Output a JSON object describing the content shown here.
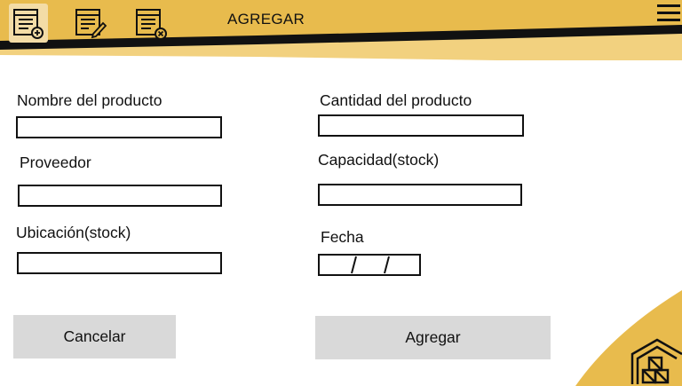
{
  "colors": {
    "accent": "#e8bb4d",
    "accent_light": "#f2d17f",
    "band_dark": "#111111",
    "button_bg": "#d9d9d9"
  },
  "toolbar": {
    "title": "AGREGAR",
    "icons": [
      "document-add-icon",
      "document-edit-icon",
      "document-delete-icon",
      "menu-icon"
    ]
  },
  "form": {
    "nombre_label": "Nombre del producto",
    "nombre_value": "",
    "proveedor_label": "Proveedor",
    "proveedor_value": "",
    "ubicacion_label": "Ubicación(stock)",
    "ubicacion_value": "",
    "cantidad_label": "Cantidad del producto",
    "cantidad_value": "",
    "capacidad_label": "Capacidad(stock)",
    "capacidad_value": "",
    "fecha_label": "Fecha",
    "fecha_value": ""
  },
  "buttons": {
    "cancel": "Cancelar",
    "add": "Agregar"
  },
  "corner_icon": "warehouse-icon"
}
